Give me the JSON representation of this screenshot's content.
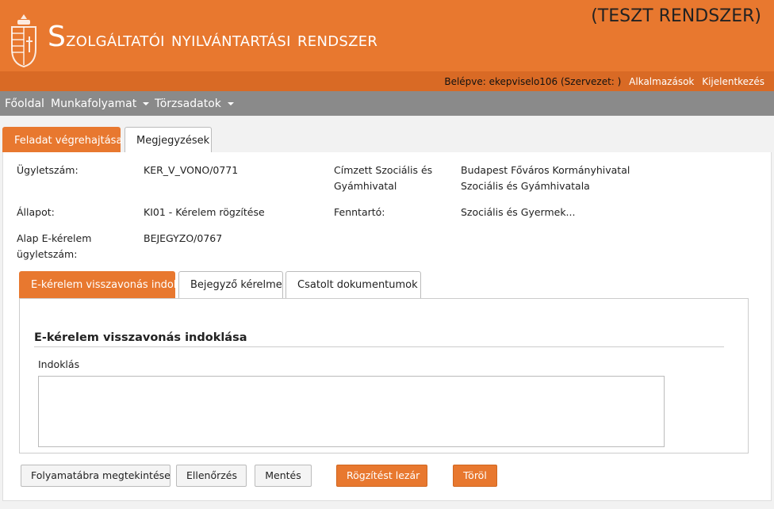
{
  "header": {
    "title_first": "S",
    "title_rest": "zolgáltatói nyilvántartási rendszer",
    "test_label": "(TESZT RENDSZER)",
    "user_prefix": "Belépve: ekepviselo106 (Szervezet: )",
    "links": [
      "Alkalmazások",
      "Kijelentkezés"
    ],
    "crest_icon": "hungarian-coat-of-arms-icon"
  },
  "nav": {
    "items": [
      "Főoldal",
      "Munkafolyamat",
      "Törzsadatok"
    ]
  },
  "tabs": {
    "main": [
      "Feladat végrehajtása",
      "Megjegyzések"
    ],
    "sub": [
      "E-kérelem visszavonás indok",
      "Bejegyző kérelme",
      "Csatolt dokumentumok"
    ]
  },
  "details": {
    "ugyletszam_label": "Ügyletszám:",
    "ugyletszam_value": "KER_V_VONO/0771",
    "cimzett_label_1": "Címzett Szociális és",
    "cimzett_label_2": "Gyámhivatal",
    "cimzett_value_1": "Budapest Főváros Kormányhivatal",
    "cimzett_value_2": "Szociális és Gyámhivatala",
    "allapot_label": "Állapot:",
    "allapot_value": "KI01 - Kérelem rögzítése",
    "fenntarto_label": "Fenntartó:",
    "fenntarto_value": "Szociális és Gyermek...",
    "alap_label_1": "Alap E-kérelem",
    "alap_label_2": "ügyletszám:",
    "alap_value": "BEJEGYZO/0767"
  },
  "form": {
    "section_title": "E-kérelem visszavonás indoklása",
    "indoklas_label": "Indoklás",
    "indoklas_value": ""
  },
  "buttons": {
    "folyamatabra": "Folyamatábra megtekintése",
    "ellenorzes": "Ellenőrzés",
    "mentes": "Mentés",
    "rogzites_lezar": "Rögzítést lezár",
    "torol": "Töröl"
  },
  "colors": {
    "brand_orange": "#e8782f",
    "nav_gray": "#8a8a8a"
  }
}
